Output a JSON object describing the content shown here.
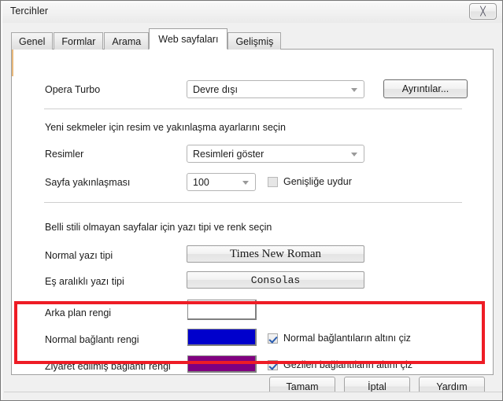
{
  "window": {
    "title": "Tercihler",
    "close_icon": "close-icon",
    "close_glyph": "╳"
  },
  "tabs": [
    {
      "label": "Genel",
      "selected": false
    },
    {
      "label": "Formlar",
      "selected": false
    },
    {
      "label": "Arama",
      "selected": false
    },
    {
      "label": "Web sayfaları",
      "selected": true
    },
    {
      "label": "Gelişmiş",
      "selected": false
    }
  ],
  "panel": {
    "turbo": {
      "label": "Opera Turbo",
      "value": "Devre dışı",
      "details_button": "Ayrıntılar..."
    },
    "images_section": {
      "note": "Yeni sekmeler için resim ve yakınlaşma ayarlarını seçin",
      "images_label": "Resimler",
      "images_value": "Resimleri göster",
      "zoom_label": "Sayfa yakınlaşması",
      "zoom_value": "100",
      "fit_width_label": "Genişliğe uydur",
      "fit_width_checked": false
    },
    "fonts_section": {
      "note": "Belli stili olmayan sayfalar için yazı tipi ve renk seçin",
      "normal_font_label": "Normal yazı tipi",
      "normal_font_value": "Times New Roman",
      "mono_font_label": "Eş aralıklı yazı tipi",
      "mono_font_value": "Consolas",
      "background_label": "Arka plan rengi",
      "background_color": "#ffffff"
    },
    "links_section": {
      "normal_link_label": "Normal bağlantı rengi",
      "normal_link_color": "#0000cc",
      "normal_underline_label": "Normal bağlantıların altını çiz",
      "normal_underline_checked": true,
      "visited_link_label": "Ziyaret edilmiş bağlantı rengi",
      "visited_link_color": "#800080",
      "visited_underline_label": "Gezilen bağlantıların altını çiz",
      "visited_underline_checked": true
    }
  },
  "footer": {
    "ok": "Tamam",
    "cancel": "İptal",
    "help": "Yardım"
  },
  "annotation": {
    "highlight_color": "#ee1c25"
  }
}
